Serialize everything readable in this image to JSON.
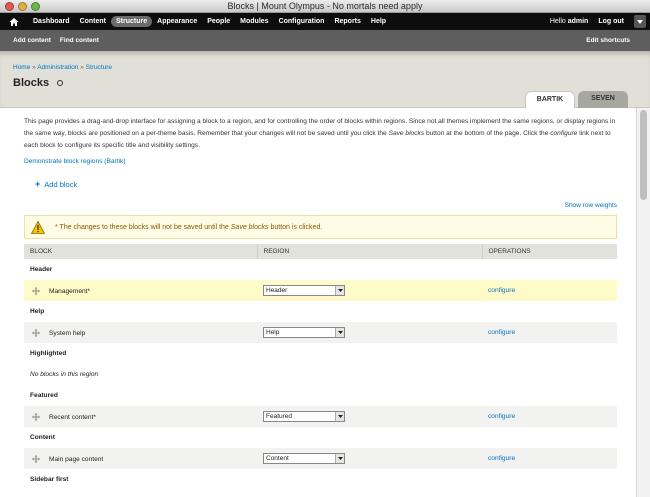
{
  "window": {
    "title": "Blocks | Mount Olympus - No mortals need apply"
  },
  "toolbar": {
    "menu": [
      "Dashboard",
      "Content",
      "Structure",
      "Appearance",
      "People",
      "Modules",
      "Configuration",
      "Reports",
      "Help"
    ],
    "active": "Structure",
    "hello_prefix": "Hello ",
    "user": "admin",
    "logout": "Log out"
  },
  "shortcuts": {
    "items": [
      "Add content",
      "Find content"
    ],
    "edit": "Edit shortcuts"
  },
  "header": {
    "breadcrumb": [
      "Home",
      "Administration",
      "Structure"
    ],
    "breadcrumb_sep": " » ",
    "title": "Blocks",
    "tabs": [
      "BARTIK",
      "SEVEN"
    ]
  },
  "main": {
    "desc_1": "This page provides a drag-and-drop interface for assigning a block to a region, and for controlling the order of blocks within regions. Since not all themes implement the same regions, or display regions in the same way, blocks are positioned on a per-theme basis. Remember that your changes will not be saved until you click the ",
    "desc_em1": "Save blocks",
    "desc_2": " button at the bottom of the page. Click the ",
    "desc_em2": "configure",
    "desc_3": " link next to each block to configure its specific title and visibility settings.",
    "demo_link": "Demonstrate block regions (Bartik)",
    "add_block": "Add block",
    "row_weights": "Show row weights",
    "warning_1": "* The changes to these blocks will not be saved until the ",
    "warning_em": "Save blocks",
    "warning_2": " button is clicked."
  },
  "table": {
    "headers": [
      "BLOCK",
      "REGION",
      "OPERATIONS"
    ],
    "regions": [
      {
        "name": "Header",
        "block": "Management*",
        "region": "Header",
        "op": "configure",
        "highlight": true
      },
      {
        "name": "Help",
        "block": "System help",
        "region": "Help",
        "op": "configure"
      },
      {
        "name": "Highlighted",
        "empty": "No blocks in this region"
      },
      {
        "name": "Featured",
        "block": "Recent content*",
        "region": "Featured",
        "op": "configure"
      },
      {
        "name": "Content",
        "block": "Main page content",
        "region": "Content",
        "op": "configure"
      },
      {
        "name": "Sidebar first"
      }
    ]
  },
  "icons": [
    "home-icon",
    "drawer-toggle-icon",
    "refresh-circle-icon",
    "plus-icon",
    "warning-icon",
    "drag-handle-icon",
    "dropdown-arrow-icon"
  ]
}
